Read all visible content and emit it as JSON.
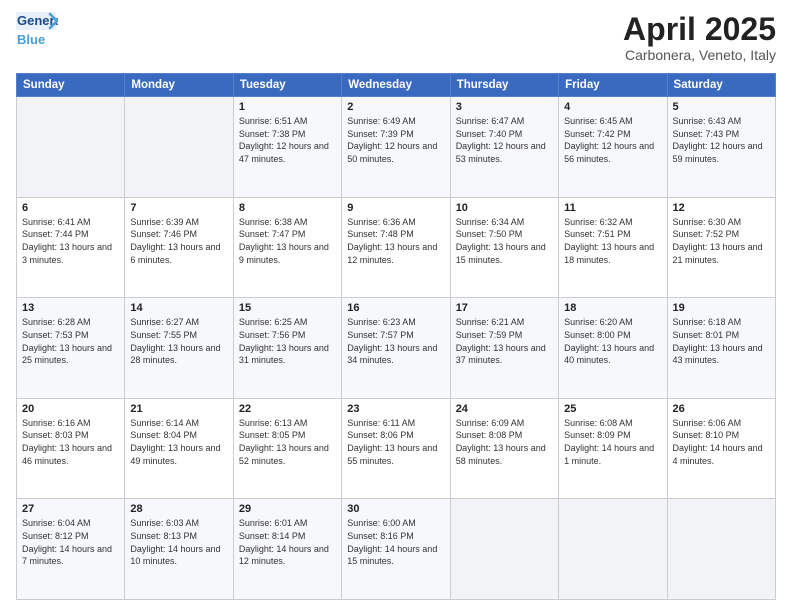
{
  "logo": {
    "line1": "General",
    "line2": "Blue"
  },
  "title": "April 2025",
  "location": "Carbonera, Veneto, Italy",
  "days_header": [
    "Sunday",
    "Monday",
    "Tuesday",
    "Wednesday",
    "Thursday",
    "Friday",
    "Saturday"
  ],
  "weeks": [
    [
      {
        "day": "",
        "info": ""
      },
      {
        "day": "",
        "info": ""
      },
      {
        "day": "1",
        "info": "Sunrise: 6:51 AM\nSunset: 7:38 PM\nDaylight: 12 hours and 47 minutes."
      },
      {
        "day": "2",
        "info": "Sunrise: 6:49 AM\nSunset: 7:39 PM\nDaylight: 12 hours and 50 minutes."
      },
      {
        "day": "3",
        "info": "Sunrise: 6:47 AM\nSunset: 7:40 PM\nDaylight: 12 hours and 53 minutes."
      },
      {
        "day": "4",
        "info": "Sunrise: 6:45 AM\nSunset: 7:42 PM\nDaylight: 12 hours and 56 minutes."
      },
      {
        "day": "5",
        "info": "Sunrise: 6:43 AM\nSunset: 7:43 PM\nDaylight: 12 hours and 59 minutes."
      }
    ],
    [
      {
        "day": "6",
        "info": "Sunrise: 6:41 AM\nSunset: 7:44 PM\nDaylight: 13 hours and 3 minutes."
      },
      {
        "day": "7",
        "info": "Sunrise: 6:39 AM\nSunset: 7:46 PM\nDaylight: 13 hours and 6 minutes."
      },
      {
        "day": "8",
        "info": "Sunrise: 6:38 AM\nSunset: 7:47 PM\nDaylight: 13 hours and 9 minutes."
      },
      {
        "day": "9",
        "info": "Sunrise: 6:36 AM\nSunset: 7:48 PM\nDaylight: 13 hours and 12 minutes."
      },
      {
        "day": "10",
        "info": "Sunrise: 6:34 AM\nSunset: 7:50 PM\nDaylight: 13 hours and 15 minutes."
      },
      {
        "day": "11",
        "info": "Sunrise: 6:32 AM\nSunset: 7:51 PM\nDaylight: 13 hours and 18 minutes."
      },
      {
        "day": "12",
        "info": "Sunrise: 6:30 AM\nSunset: 7:52 PM\nDaylight: 13 hours and 21 minutes."
      }
    ],
    [
      {
        "day": "13",
        "info": "Sunrise: 6:28 AM\nSunset: 7:53 PM\nDaylight: 13 hours and 25 minutes."
      },
      {
        "day": "14",
        "info": "Sunrise: 6:27 AM\nSunset: 7:55 PM\nDaylight: 13 hours and 28 minutes."
      },
      {
        "day": "15",
        "info": "Sunrise: 6:25 AM\nSunset: 7:56 PM\nDaylight: 13 hours and 31 minutes."
      },
      {
        "day": "16",
        "info": "Sunrise: 6:23 AM\nSunset: 7:57 PM\nDaylight: 13 hours and 34 minutes."
      },
      {
        "day": "17",
        "info": "Sunrise: 6:21 AM\nSunset: 7:59 PM\nDaylight: 13 hours and 37 minutes."
      },
      {
        "day": "18",
        "info": "Sunrise: 6:20 AM\nSunset: 8:00 PM\nDaylight: 13 hours and 40 minutes."
      },
      {
        "day": "19",
        "info": "Sunrise: 6:18 AM\nSunset: 8:01 PM\nDaylight: 13 hours and 43 minutes."
      }
    ],
    [
      {
        "day": "20",
        "info": "Sunrise: 6:16 AM\nSunset: 8:03 PM\nDaylight: 13 hours and 46 minutes."
      },
      {
        "day": "21",
        "info": "Sunrise: 6:14 AM\nSunset: 8:04 PM\nDaylight: 13 hours and 49 minutes."
      },
      {
        "day": "22",
        "info": "Sunrise: 6:13 AM\nSunset: 8:05 PM\nDaylight: 13 hours and 52 minutes."
      },
      {
        "day": "23",
        "info": "Sunrise: 6:11 AM\nSunset: 8:06 PM\nDaylight: 13 hours and 55 minutes."
      },
      {
        "day": "24",
        "info": "Sunrise: 6:09 AM\nSunset: 8:08 PM\nDaylight: 13 hours and 58 minutes."
      },
      {
        "day": "25",
        "info": "Sunrise: 6:08 AM\nSunset: 8:09 PM\nDaylight: 14 hours and 1 minute."
      },
      {
        "day": "26",
        "info": "Sunrise: 6:06 AM\nSunset: 8:10 PM\nDaylight: 14 hours and 4 minutes."
      }
    ],
    [
      {
        "day": "27",
        "info": "Sunrise: 6:04 AM\nSunset: 8:12 PM\nDaylight: 14 hours and 7 minutes."
      },
      {
        "day": "28",
        "info": "Sunrise: 6:03 AM\nSunset: 8:13 PM\nDaylight: 14 hours and 10 minutes."
      },
      {
        "day": "29",
        "info": "Sunrise: 6:01 AM\nSunset: 8:14 PM\nDaylight: 14 hours and 12 minutes."
      },
      {
        "day": "30",
        "info": "Sunrise: 6:00 AM\nSunset: 8:16 PM\nDaylight: 14 hours and 15 minutes."
      },
      {
        "day": "",
        "info": ""
      },
      {
        "day": "",
        "info": ""
      },
      {
        "day": "",
        "info": ""
      }
    ]
  ]
}
